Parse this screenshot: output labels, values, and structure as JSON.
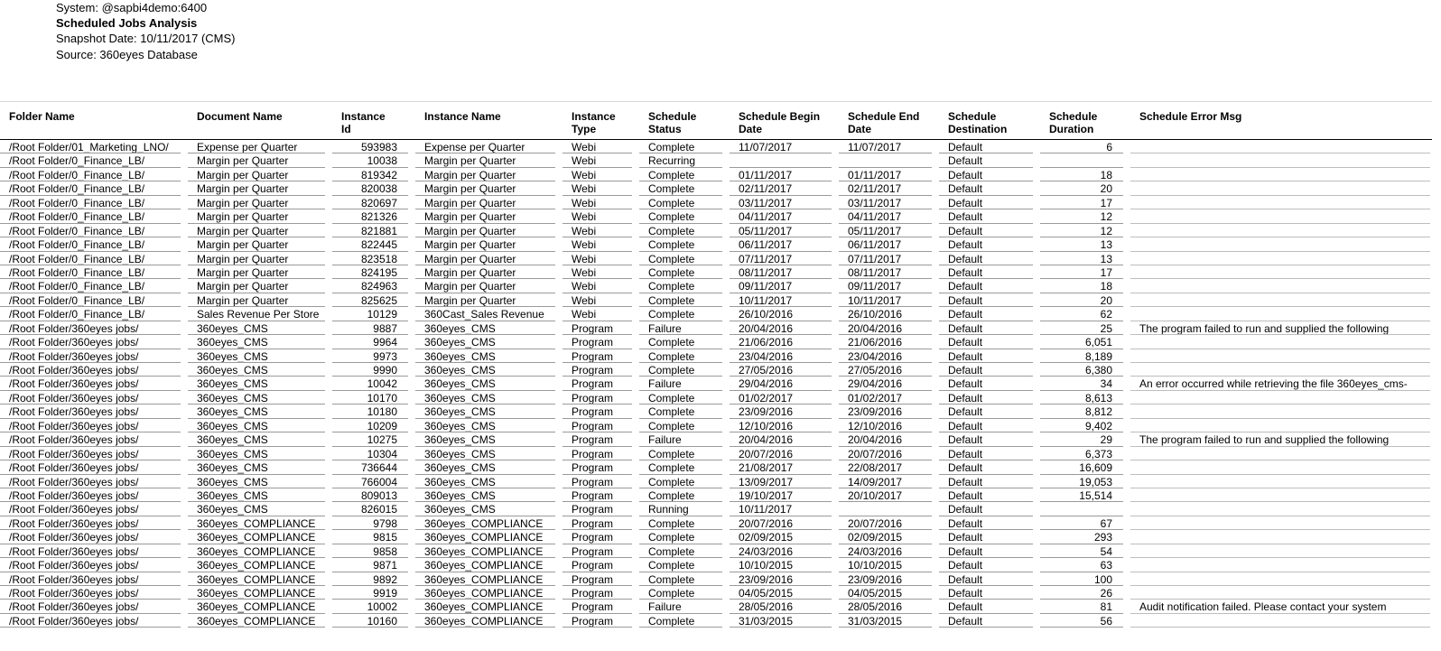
{
  "report": {
    "system_line": "System: @sapbi4demo:6400",
    "title": "Scheduled Jobs Analysis",
    "snapshot_line": "Snapshot Date: 10/11/2017 (CMS)",
    "source_line": "Source: 360eyes Database"
  },
  "table": {
    "columns": [
      {
        "key": "folder_name",
        "label": "Folder Name",
        "align": "left"
      },
      {
        "key": "document_name",
        "label": "Document Name",
        "align": "left"
      },
      {
        "key": "instance_id",
        "label": "Instance\nId",
        "align": "right"
      },
      {
        "key": "instance_name",
        "label": "Instance Name",
        "align": "left"
      },
      {
        "key": "instance_type",
        "label": "Instance\nType",
        "align": "left"
      },
      {
        "key": "schedule_status",
        "label": "Schedule\nStatus",
        "align": "left"
      },
      {
        "key": "schedule_begin_date",
        "label": "Schedule Begin\nDate",
        "align": "left"
      },
      {
        "key": "schedule_end_date",
        "label": "Schedule End\nDate",
        "align": "left"
      },
      {
        "key": "schedule_destination",
        "label": "Schedule\nDestination",
        "align": "left"
      },
      {
        "key": "schedule_duration",
        "label": "Schedule\nDuration",
        "align": "right"
      },
      {
        "key": "schedule_error_msg",
        "label": "Schedule Error Msg",
        "align": "left"
      }
    ],
    "rows": [
      [
        "/Root Folder/01_Marketing_LNO/",
        "Expense per Quarter",
        "593983",
        "Expense per Quarter",
        "Webi",
        "Complete",
        "11/07/2017",
        "11/07/2017",
        "Default",
        "6",
        ""
      ],
      [
        "/Root Folder/0_Finance_LB/",
        "Margin per Quarter",
        "10038",
        "Margin per Quarter",
        "Webi",
        "Recurring",
        "",
        "",
        "Default",
        "",
        ""
      ],
      [
        "/Root Folder/0_Finance_LB/",
        "Margin per Quarter",
        "819342",
        "Margin per Quarter",
        "Webi",
        "Complete",
        "01/11/2017",
        "01/11/2017",
        "Default",
        "18",
        ""
      ],
      [
        "/Root Folder/0_Finance_LB/",
        "Margin per Quarter",
        "820038",
        "Margin per Quarter",
        "Webi",
        "Complete",
        "02/11/2017",
        "02/11/2017",
        "Default",
        "20",
        ""
      ],
      [
        "/Root Folder/0_Finance_LB/",
        "Margin per Quarter",
        "820697",
        "Margin per Quarter",
        "Webi",
        "Complete",
        "03/11/2017",
        "03/11/2017",
        "Default",
        "17",
        ""
      ],
      [
        "/Root Folder/0_Finance_LB/",
        "Margin per Quarter",
        "821326",
        "Margin per Quarter",
        "Webi",
        "Complete",
        "04/11/2017",
        "04/11/2017",
        "Default",
        "12",
        ""
      ],
      [
        "/Root Folder/0_Finance_LB/",
        "Margin per Quarter",
        "821881",
        "Margin per Quarter",
        "Webi",
        "Complete",
        "05/11/2017",
        "05/11/2017",
        "Default",
        "12",
        ""
      ],
      [
        "/Root Folder/0_Finance_LB/",
        "Margin per Quarter",
        "822445",
        "Margin per Quarter",
        "Webi",
        "Complete",
        "06/11/2017",
        "06/11/2017",
        "Default",
        "13",
        ""
      ],
      [
        "/Root Folder/0_Finance_LB/",
        "Margin per Quarter",
        "823518",
        "Margin per Quarter",
        "Webi",
        "Complete",
        "07/11/2017",
        "07/11/2017",
        "Default",
        "13",
        ""
      ],
      [
        "/Root Folder/0_Finance_LB/",
        "Margin per Quarter",
        "824195",
        "Margin per Quarter",
        "Webi",
        "Complete",
        "08/11/2017",
        "08/11/2017",
        "Default",
        "17",
        ""
      ],
      [
        "/Root Folder/0_Finance_LB/",
        "Margin per Quarter",
        "824963",
        "Margin per Quarter",
        "Webi",
        "Complete",
        "09/11/2017",
        "09/11/2017",
        "Default",
        "18",
        ""
      ],
      [
        "/Root Folder/0_Finance_LB/",
        "Margin per Quarter",
        "825625",
        "Margin per Quarter",
        "Webi",
        "Complete",
        "10/11/2017",
        "10/11/2017",
        "Default",
        "20",
        ""
      ],
      [
        "/Root Folder/0_Finance_LB/",
        "Sales Revenue Per Store",
        "10129",
        "360Cast_Sales Revenue",
        "Webi",
        "Complete",
        "26/10/2016",
        "26/10/2016",
        "Default",
        "62",
        ""
      ],
      [
        "/Root Folder/360eyes jobs/",
        "360eyes_CMS",
        "9887",
        "360eyes_CMS",
        "Program",
        "Failure",
        "20/04/2016",
        "20/04/2016",
        "Default",
        "25",
        "The program failed to run and supplied the following"
      ],
      [
        "/Root Folder/360eyes jobs/",
        "360eyes_CMS",
        "9964",
        "360eyes_CMS",
        "Program",
        "Complete",
        "21/06/2016",
        "21/06/2016",
        "Default",
        "6,051",
        ""
      ],
      [
        "/Root Folder/360eyes jobs/",
        "360eyes_CMS",
        "9973",
        "360eyes_CMS",
        "Program",
        "Complete",
        "23/04/2016",
        "23/04/2016",
        "Default",
        "8,189",
        ""
      ],
      [
        "/Root Folder/360eyes jobs/",
        "360eyes_CMS",
        "9990",
        "360eyes_CMS",
        "Program",
        "Complete",
        "27/05/2016",
        "27/05/2016",
        "Default",
        "6,380",
        ""
      ],
      [
        "/Root Folder/360eyes jobs/",
        "360eyes_CMS",
        "10042",
        "360eyes_CMS",
        "Program",
        "Failure",
        "29/04/2016",
        "29/04/2016",
        "Default",
        "34",
        "An error occurred while retrieving the file 360eyes_cms-"
      ],
      [
        "/Root Folder/360eyes jobs/",
        "360eyes_CMS",
        "10170",
        "360eyes_CMS",
        "Program",
        "Complete",
        "01/02/2017",
        "01/02/2017",
        "Default",
        "8,613",
        ""
      ],
      [
        "/Root Folder/360eyes jobs/",
        "360eyes_CMS",
        "10180",
        "360eyes_CMS",
        "Program",
        "Complete",
        "23/09/2016",
        "23/09/2016",
        "Default",
        "8,812",
        ""
      ],
      [
        "/Root Folder/360eyes jobs/",
        "360eyes_CMS",
        "10209",
        "360eyes_CMS",
        "Program",
        "Complete",
        "12/10/2016",
        "12/10/2016",
        "Default",
        "9,402",
        ""
      ],
      [
        "/Root Folder/360eyes jobs/",
        "360eyes_CMS",
        "10275",
        "360eyes_CMS",
        "Program",
        "Failure",
        "20/04/2016",
        "20/04/2016",
        "Default",
        "29",
        "The program failed to run and supplied the following"
      ],
      [
        "/Root Folder/360eyes jobs/",
        "360eyes_CMS",
        "10304",
        "360eyes_CMS",
        "Program",
        "Complete",
        "20/07/2016",
        "20/07/2016",
        "Default",
        "6,373",
        ""
      ],
      [
        "/Root Folder/360eyes jobs/",
        "360eyes_CMS",
        "736644",
        "360eyes_CMS",
        "Program",
        "Complete",
        "21/08/2017",
        "22/08/2017",
        "Default",
        "16,609",
        ""
      ],
      [
        "/Root Folder/360eyes jobs/",
        "360eyes_CMS",
        "766004",
        "360eyes_CMS",
        "Program",
        "Complete",
        "13/09/2017",
        "14/09/2017",
        "Default",
        "19,053",
        ""
      ],
      [
        "/Root Folder/360eyes jobs/",
        "360eyes_CMS",
        "809013",
        "360eyes_CMS",
        "Program",
        "Complete",
        "19/10/2017",
        "20/10/2017",
        "Default",
        "15,514",
        ""
      ],
      [
        "/Root Folder/360eyes jobs/",
        "360eyes_CMS",
        "826015",
        "360eyes_CMS",
        "Program",
        "Running",
        "10/11/2017",
        "",
        "Default",
        "",
        ""
      ],
      [
        "/Root Folder/360eyes jobs/",
        "360eyes_COMPLIANCE",
        "9798",
        "360eyes_COMPLIANCE",
        "Program",
        "Complete",
        "20/07/2016",
        "20/07/2016",
        "Default",
        "67",
        ""
      ],
      [
        "/Root Folder/360eyes jobs/",
        "360eyes_COMPLIANCE",
        "9815",
        "360eyes_COMPLIANCE",
        "Program",
        "Complete",
        "02/09/2015",
        "02/09/2015",
        "Default",
        "293",
        ""
      ],
      [
        "/Root Folder/360eyes jobs/",
        "360eyes_COMPLIANCE",
        "9858",
        "360eyes_COMPLIANCE",
        "Program",
        "Complete",
        "24/03/2016",
        "24/03/2016",
        "Default",
        "54",
        ""
      ],
      [
        "/Root Folder/360eyes jobs/",
        "360eyes_COMPLIANCE",
        "9871",
        "360eyes_COMPLIANCE",
        "Program",
        "Complete",
        "10/10/2015",
        "10/10/2015",
        "Default",
        "63",
        ""
      ],
      [
        "/Root Folder/360eyes jobs/",
        "360eyes_COMPLIANCE",
        "9892",
        "360eyes_COMPLIANCE",
        "Program",
        "Complete",
        "23/09/2016",
        "23/09/2016",
        "Default",
        "100",
        ""
      ],
      [
        "/Root Folder/360eyes jobs/",
        "360eyes_COMPLIANCE",
        "9919",
        "360eyes_COMPLIANCE",
        "Program",
        "Complete",
        "04/05/2015",
        "04/05/2015",
        "Default",
        "26",
        ""
      ],
      [
        "/Root Folder/360eyes jobs/",
        "360eyes_COMPLIANCE",
        "10002",
        "360eyes_COMPLIANCE",
        "Program",
        "Failure",
        "28/05/2016",
        "28/05/2016",
        "Default",
        "81",
        "Audit notification failed.  Please contact your system"
      ],
      [
        "/Root Folder/360eyes jobs/",
        "360eyes_COMPLIANCE",
        "10160",
        "360eyes_COMPLIANCE",
        "Program",
        "Complete",
        "31/03/2015",
        "31/03/2015",
        "Default",
        "56",
        ""
      ]
    ]
  }
}
